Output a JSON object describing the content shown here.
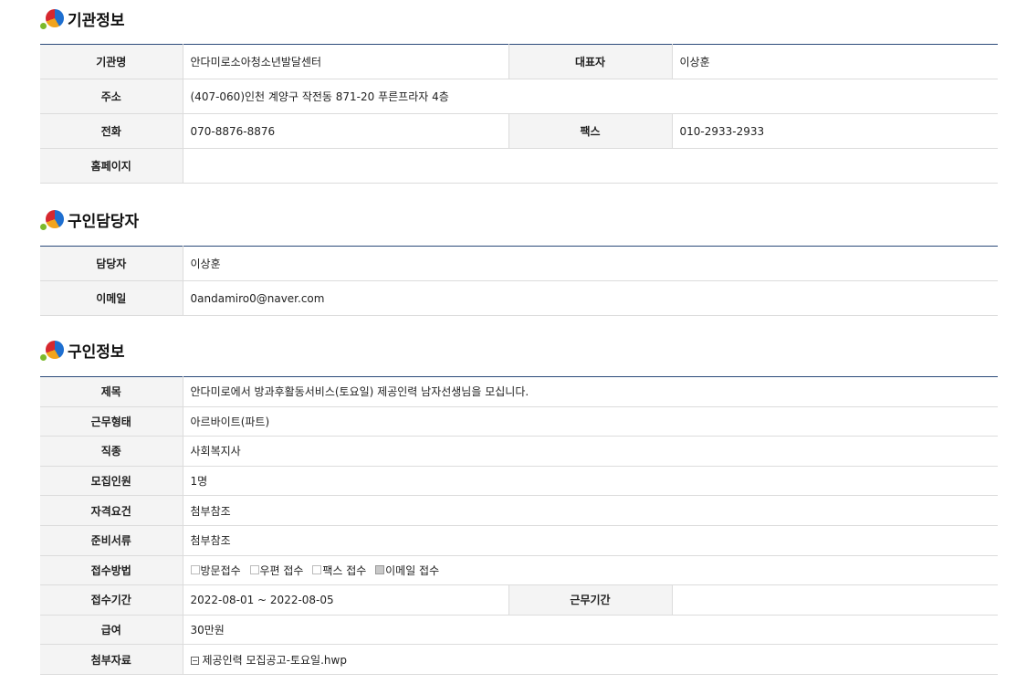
{
  "sections": {
    "org": {
      "title": "기관정보"
    },
    "contact": {
      "title": "구인담당자"
    },
    "job": {
      "title": "구인정보"
    }
  },
  "org": {
    "name_label": "기관명",
    "name": "안다미로소아청소년발달센터",
    "rep_label": "대표자",
    "rep": "이상훈",
    "addr_label": "주소",
    "addr": "(407-060)인천 계양구 작전동 871-20 푸른프라자 4층",
    "phone_label": "전화",
    "phone": "070-8876-8876",
    "fax_label": "팩스",
    "fax": "010-2933-2933",
    "homepage_label": "홈페이지",
    "homepage": ""
  },
  "contact": {
    "person_label": "담당자",
    "person": "이상훈",
    "email_label": "이메일",
    "email": "0andamiro0@naver.com"
  },
  "job": {
    "title_label": "제목",
    "title": "안다미로에서 방과후활동서비스(토요일) 제공인력 남자선생님을 모십니다.",
    "type_label": "근무형태",
    "type": "아르바이트(파트)",
    "occupation_label": "직종",
    "occupation": "사회복지사",
    "count_label": "모집인원",
    "count": "1명",
    "qualification_label": "자격요건",
    "qualification": "첨부참조",
    "documents_label": "준비서류",
    "documents": "첨부참조",
    "method_label": "접수방법",
    "methods": [
      {
        "label": "방문접수",
        "checked": false
      },
      {
        "label": "우편 접수",
        "checked": false
      },
      {
        "label": "팩스 접수",
        "checked": false
      },
      {
        "label": "이메일 접수",
        "checked": true
      }
    ],
    "period_label": "접수기간",
    "period": "2022-08-01 ~ 2022-08-05",
    "work_period_label": "근무기간",
    "work_period": "",
    "salary_label": "급여",
    "salary": "30만원",
    "attachment_label": "첨부자료",
    "attachment": "제공인력 모집공고-토요일.hwp"
  }
}
